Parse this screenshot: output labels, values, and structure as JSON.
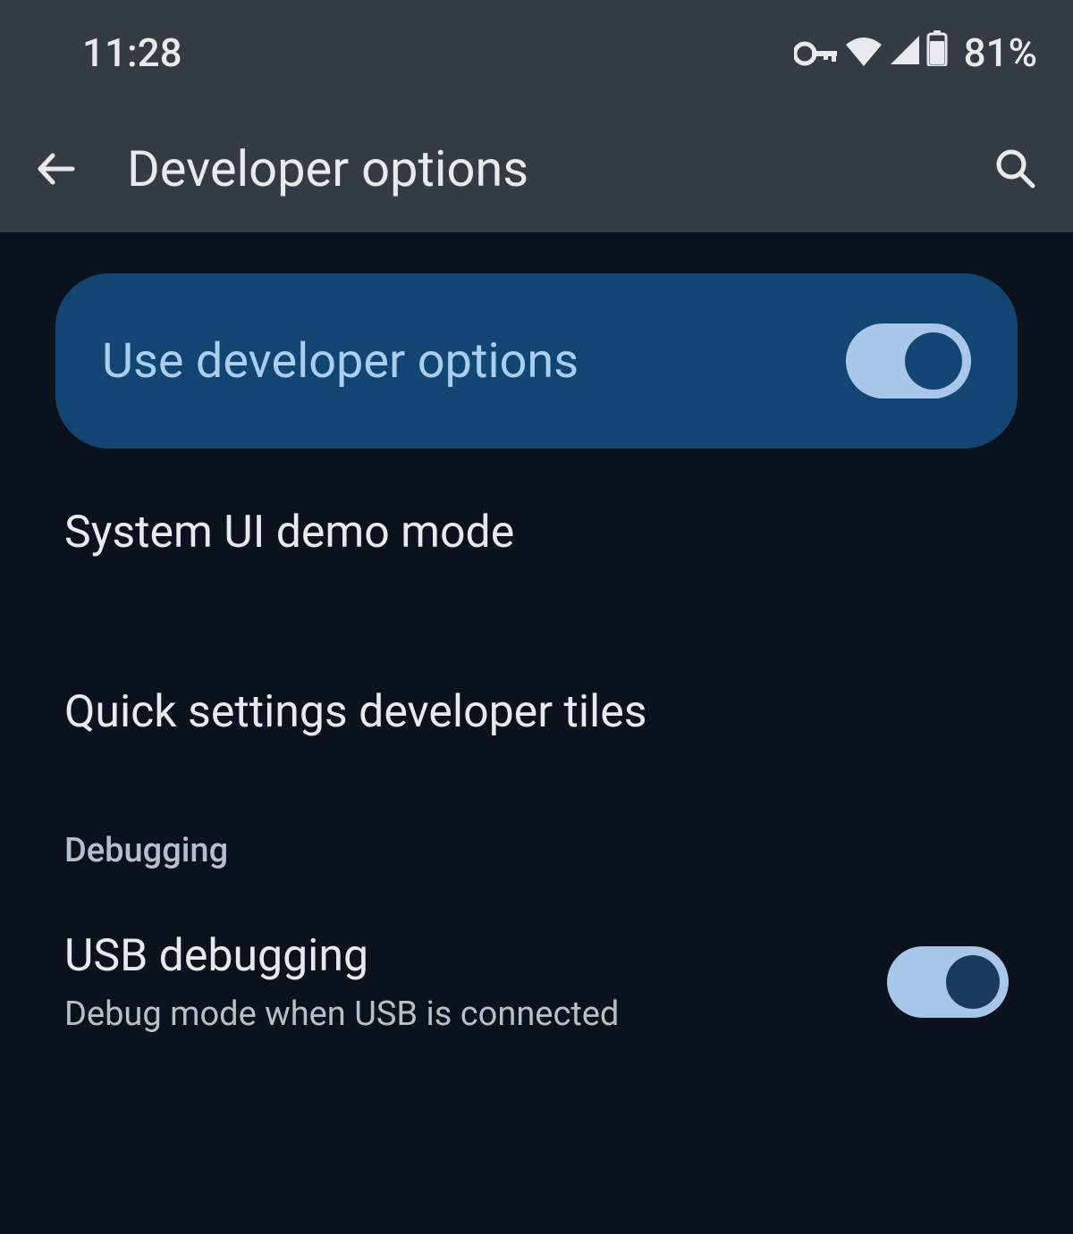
{
  "statusBar": {
    "time": "11:28",
    "battery": "81%"
  },
  "appBar": {
    "title": "Developer options"
  },
  "hero": {
    "label": "Use developer options",
    "enabled": true
  },
  "items": [
    {
      "title": "System UI demo mode"
    },
    {
      "title": "Quick settings developer tiles"
    }
  ],
  "sections": [
    {
      "header": "Debugging",
      "items": [
        {
          "title": "USB debugging",
          "subtitle": "Debug mode when USB is connected",
          "enabled": true
        }
      ]
    }
  ]
}
